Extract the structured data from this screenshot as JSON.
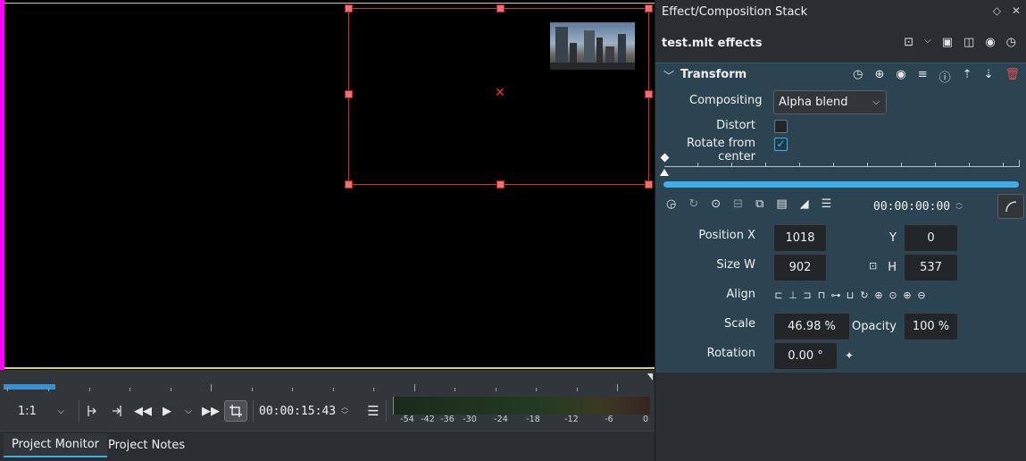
{
  "monitor": {
    "zoom_label": "1:1",
    "timecode": "00:00:15:43",
    "meter_labels": [
      "-54",
      "-42",
      "-36",
      "-30",
      "-24",
      "-18",
      "-12",
      "-6",
      "0"
    ],
    "tabs": [
      {
        "label": "Project Monitor",
        "active": true
      },
      {
        "label": "Project Notes",
        "active": false
      }
    ]
  },
  "stack": {
    "title": "Effect/Composition Stack",
    "subtitle": "test.mlt effects",
    "effect": {
      "name": "Transform",
      "compositing_label": "Compositing",
      "compositing_value": "Alpha blend",
      "distort_label": "Distort",
      "distort_checked": false,
      "rotate_label": "Rotate from center",
      "rotate_checked": true,
      "keyframe_timecode": "00:00:00:00",
      "position_x_label": "Position X",
      "position_x": "1018",
      "y_label": "Y",
      "y": "0",
      "size_w_label": "Size W",
      "size_w": "902",
      "h_label": "H",
      "h": "537",
      "align_label": "Align",
      "scale_label": "Scale",
      "scale": "46.98 %",
      "opacity_label": "Opacity",
      "opacity": "100 %",
      "rotation_label": "Rotation",
      "rotation": "0.00 °"
    }
  },
  "colors": {
    "accent": "#3daee9",
    "effect_bg": "#2c4351",
    "monitor_guide": "#ff00ff",
    "frame_border": "#d32f2f"
  }
}
